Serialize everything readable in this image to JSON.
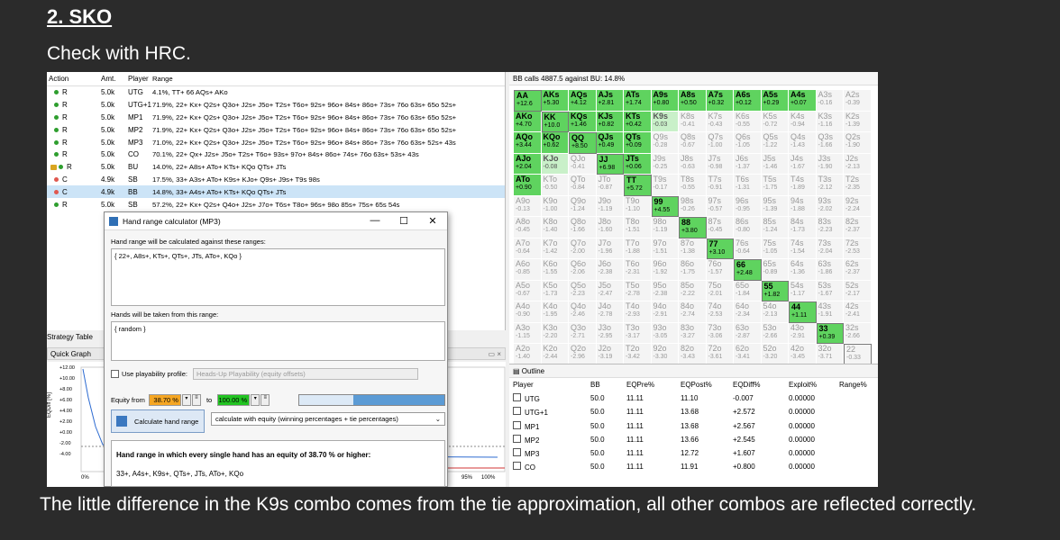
{
  "slide": {
    "title": "2. SKO",
    "subtitle": "Check with HRC.",
    "caption": "The little difference in the K9s combo comes from the tie approximation, all other combos are reflected correctly."
  },
  "action_table": {
    "headers": {
      "action": "Action",
      "amt": "Amt.",
      "player": "Player",
      "range": "Range"
    },
    "rows": [
      {
        "action": "R",
        "amt": "5.0k",
        "player": "UTG",
        "range": "4.1%, TT+ 66 AQs+ AKo",
        "color": "#2e9e2e"
      },
      {
        "action": "R",
        "amt": "5.0k",
        "player": "UTG+1",
        "range": "71.9%, 22+ Kx+ Q2s+ Q3o+ J2s+ J5o+ T2s+ T6o+ 92s+ 96o+ 84s+ 86o+ 73s+ 76o 63s+ 65o 52s+",
        "color": "#2e9e2e"
      },
      {
        "action": "R",
        "amt": "5.0k",
        "player": "MP1",
        "range": "71.9%, 22+ Kx+ Q2s+ Q3o+ J2s+ J5o+ T2s+ T6o+ 92s+ 96o+ 84s+ 86o+ 73s+ 76o 63s+ 65o 52s+",
        "color": "#2e9e2e"
      },
      {
        "action": "R",
        "amt": "5.0k",
        "player": "MP2",
        "range": "71.9%, 22+ Kx+ Q2s+ Q3o+ J2s+ J5o+ T2s+ T6o+ 92s+ 96o+ 84s+ 86o+ 73s+ 76o 63s+ 65o 52s+",
        "color": "#2e9e2e"
      },
      {
        "action": "R",
        "amt": "5.0k",
        "player": "MP3",
        "range": "71.0%, 22+ Kx+ Q2s+ Q3o+ J2s+ J5o+ T2s+ T6o+ 92s+ 96o+ 84s+ 86o+ 73s+ 76o 63s+ 52s+ 43s",
        "color": "#2e9e2e"
      },
      {
        "action": "R",
        "amt": "5.0k",
        "player": "CO",
        "range": "70.1%, 22+ Qx+ J2s+ J5o+ T2s+ T6o+ 93s+ 97o+ 84s+ 86o+ 74s+ 76o 63s+ 53s+ 43s",
        "color": "#2e9e2e"
      },
      {
        "action": "R",
        "amt": "5.0k",
        "player": "BU",
        "range": "14.0%, 22+ A8s+ ATo+ KTs+ KQo QTs+ JTs",
        "color": "#2e9e2e",
        "lock": true
      },
      {
        "action": "C",
        "amt": "4.9k",
        "player": "SB",
        "range": "17.5%, 33+ A3s+ ATo+ K9s+ KJo+ Q9s+ J9s+ T9s 98s",
        "color": "#e0584f"
      },
      {
        "action": "C",
        "amt": "4.9k",
        "player": "BB",
        "range": "14.8%, 33+ A4s+ ATo+ KTs+ KQo QTs+ JTs",
        "color": "#e0584f",
        "selected": true
      },
      {
        "action": "R",
        "amt": "5.0k",
        "player": "SB",
        "range": "57.2%, 22+ Kx+ Q2s+ Q4o+ J2s+ J7o+ T6s+ T8o+ 96s+ 98o 85s+ 75s+ 65s 54s",
        "color": "#2e9e2e"
      }
    ]
  },
  "strategy_table_label": "Strategy Table",
  "quick_graph": {
    "label": "Quick Graph",
    "ylabel": "EQDiff [%]",
    "yticks": [
      "+12.00",
      "+10.00",
      "+8.00",
      "+6.00",
      "+4.00",
      "+2.00",
      "+0.00",
      "-2.00",
      "-4.00"
    ],
    "xticks": [
      "0%",
      "95%",
      "100%"
    ]
  },
  "dialog": {
    "title": "Hand range calculator (MP3)",
    "against_label": "Hand range will be calculated against these ranges:",
    "against_value": "{ 22+, A8s+, KTs+, QTs+, JTs, ATo+, KQo }",
    "taken_label": "Hands will be taken from this range:",
    "taken_value": "{ random }",
    "playability_label": "Use playability profile:",
    "playability_value": "Heads-Up Playability (equity offsets)",
    "equity_from_label": "Equity from",
    "equity_from_value": "38.70 %",
    "to_label": "to",
    "to_value": "100.00 %",
    "calc_button": "Calculate hand range",
    "method": "calculate with equity (winning percentages + tie percentages)",
    "result_heading": "Hand range in which every single hand has an equity of 38.70 % or higher:",
    "result_value": "33+, A4s+, K9s+, QTs+, JTs, ATo+, KQo"
  },
  "matrix": {
    "header": "BB calls 4887.5 against BU: 14.8%",
    "cells": [
      [
        "AA",
        "+12.6"
      ],
      [
        "AKs",
        "+5.30"
      ],
      [
        "AQs",
        "+4.12"
      ],
      [
        "AJs",
        "+2.81"
      ],
      [
        "ATs",
        "+1.74"
      ],
      [
        "A9s",
        "+0.80"
      ],
      [
        "A8s",
        "+0.50"
      ],
      [
        "A7s",
        "+0.32"
      ],
      [
        "A6s",
        "+0.12"
      ],
      [
        "A5s",
        "+0.29"
      ],
      [
        "A4s",
        "+0.07"
      ],
      [
        "A3s",
        "-0.16"
      ],
      [
        "A2s",
        "-0.39"
      ],
      [
        "AKo",
        "+4.70"
      ],
      [
        "KK",
        "+10.0"
      ],
      [
        "KQs",
        "+1.46"
      ],
      [
        "KJs",
        "+0.82"
      ],
      [
        "KTs",
        "+0.42"
      ],
      [
        "K9s",
        "-0.03"
      ],
      [
        "K8s",
        "-0.41"
      ],
      [
        "K7s",
        "-0.43"
      ],
      [
        "K6s",
        "-0.55"
      ],
      [
        "K5s",
        "-0.72"
      ],
      [
        "K4s",
        "-0.94"
      ],
      [
        "K3s",
        "-1.16"
      ],
      [
        "K2s",
        "-1.39"
      ],
      [
        "AQo",
        "+3.44"
      ],
      [
        "KQo",
        "+0.62"
      ],
      [
        "QQ",
        "+8.50"
      ],
      [
        "QJs",
        "+0.49"
      ],
      [
        "QTs",
        "+0.09"
      ],
      [
        "Q9s",
        "-0.28"
      ],
      [
        "Q8s",
        "-0.67"
      ],
      [
        "Q7s",
        "-1.00"
      ],
      [
        "Q6s",
        "-1.05"
      ],
      [
        "Q5s",
        "-1.22"
      ],
      [
        "Q4s",
        "-1.43"
      ],
      [
        "Q3s",
        "-1.66"
      ],
      [
        "Q2s",
        "-1.90"
      ],
      [
        "AJo",
        "+2.04"
      ],
      [
        "KJo",
        "-0.08"
      ],
      [
        "QJo",
        "-0.41"
      ],
      [
        "JJ",
        "+6.98"
      ],
      [
        "JTs",
        "+0.06"
      ],
      [
        "J9s",
        "-0.25"
      ],
      [
        "J8s",
        "-0.63"
      ],
      [
        "J7s",
        "-0.98"
      ],
      [
        "J6s",
        "-1.37"
      ],
      [
        "J5s",
        "-1.46"
      ],
      [
        "J4s",
        "-1.67"
      ],
      [
        "J3s",
        "-1.90"
      ],
      [
        "J2s",
        "-2.13"
      ],
      [
        "ATo",
        "+0.90"
      ],
      [
        "KTo",
        "-0.50"
      ],
      [
        "QTo",
        "-0.84"
      ],
      [
        "JTo",
        "-0.87"
      ],
      [
        "TT",
        "+5.72"
      ],
      [
        "T9s",
        "-0.17"
      ],
      [
        "T8s",
        "-0.55"
      ],
      [
        "T7s",
        "-0.91"
      ],
      [
        "T6s",
        "-1.31"
      ],
      [
        "T5s",
        "-1.75"
      ],
      [
        "T4s",
        "-1.89"
      ],
      [
        "T3s",
        "-2.12"
      ],
      [
        "T2s",
        "-2.35"
      ],
      [
        "A9o",
        "-0.13"
      ],
      [
        "K9o",
        "-1.00"
      ],
      [
        "Q9o",
        "-1.24"
      ],
      [
        "J9o",
        "-1.19"
      ],
      [
        "T9o",
        "-1.10"
      ],
      [
        "99",
        "+4.55"
      ],
      [
        "98s",
        "-0.26"
      ],
      [
        "97s",
        "-0.57"
      ],
      [
        "96s",
        "-0.95"
      ],
      [
        "95s",
        "-1.39"
      ],
      [
        "94s",
        "-1.88"
      ],
      [
        "93s",
        "-2.02"
      ],
      [
        "92s",
        "-2.24"
      ],
      [
        "A8o",
        "-0.45"
      ],
      [
        "K8o",
        "-1.40"
      ],
      [
        "Q8o",
        "-1.66"
      ],
      [
        "J8o",
        "-1.60"
      ],
      [
        "T8o",
        "-1.51"
      ],
      [
        "98o",
        "-1.19"
      ],
      [
        "88",
        "+3.80"
      ],
      [
        "87s",
        "-0.45"
      ],
      [
        "86s",
        "-0.80"
      ],
      [
        "85s",
        "-1.24"
      ],
      [
        "84s",
        "-1.73"
      ],
      [
        "83s",
        "-2.23"
      ],
      [
        "82s",
        "-2.37"
      ],
      [
        "A7o",
        "-0.64"
      ],
      [
        "K7o",
        "-1.42"
      ],
      [
        "Q7o",
        "-2.00"
      ],
      [
        "J7o",
        "-1.96"
      ],
      [
        "T7o",
        "-1.88"
      ],
      [
        "97o",
        "-1.51"
      ],
      [
        "87o",
        "-1.38"
      ],
      [
        "77",
        "+3.10"
      ],
      [
        "76s",
        "-0.64"
      ],
      [
        "75s",
        "-1.05"
      ],
      [
        "74s",
        "-1.54"
      ],
      [
        "73s",
        "-2.04"
      ],
      [
        "72s",
        "-2.53"
      ],
      [
        "A6o",
        "-0.85"
      ],
      [
        "K6o",
        "-1.55"
      ],
      [
        "Q6o",
        "-2.06"
      ],
      [
        "J6o",
        "-2.38"
      ],
      [
        "T6o",
        "-2.31"
      ],
      [
        "96o",
        "-1.92"
      ],
      [
        "86o",
        "-1.75"
      ],
      [
        "76o",
        "-1.57"
      ],
      [
        "66",
        "+2.48"
      ],
      [
        "65s",
        "-0.89"
      ],
      [
        "64s",
        "-1.36"
      ],
      [
        "63s",
        "-1.86"
      ],
      [
        "62s",
        "-2.37"
      ],
      [
        "A5o",
        "-0.67"
      ],
      [
        "K5o",
        "-1.73"
      ],
      [
        "Q5o",
        "-2.23"
      ],
      [
        "J5o",
        "-2.47"
      ],
      [
        "T5o",
        "-2.78"
      ],
      [
        "95o",
        "-2.38"
      ],
      [
        "85o",
        "-2.22"
      ],
      [
        "75o",
        "-2.01"
      ],
      [
        "65o",
        "-1.84"
      ],
      [
        "55",
        "+1.82"
      ],
      [
        "54s",
        "-1.17"
      ],
      [
        "53s",
        "-1.67"
      ],
      [
        "52s",
        "-2.17"
      ],
      [
        "A4o",
        "-0.90"
      ],
      [
        "K4o",
        "-1.95"
      ],
      [
        "Q4o",
        "-2.46"
      ],
      [
        "J4o",
        "-2.78"
      ],
      [
        "T4o",
        "-2.93"
      ],
      [
        "94o",
        "-2.91"
      ],
      [
        "84o",
        "-2.74"
      ],
      [
        "74o",
        "-2.53"
      ],
      [
        "64o",
        "-2.34"
      ],
      [
        "54o",
        "-2.13"
      ],
      [
        "44",
        "+1.11"
      ],
      [
        "43s",
        "-1.91"
      ],
      [
        "42s",
        "-2.41"
      ],
      [
        "A3o",
        "-1.15"
      ],
      [
        "K3o",
        "-2.20"
      ],
      [
        "Q3o",
        "-2.71"
      ],
      [
        "J3o",
        "-2.95"
      ],
      [
        "T3o",
        "-3.17"
      ],
      [
        "93o",
        "-3.05"
      ],
      [
        "83o",
        "-3.27"
      ],
      [
        "73o",
        "-3.06"
      ],
      [
        "63o",
        "-2.87"
      ],
      [
        "53o",
        "-2.66"
      ],
      [
        "43o",
        "-2.91"
      ],
      [
        "33",
        "+0.39"
      ],
      [
        "32s",
        "-2.66"
      ],
      [
        "A2o",
        "-1.40"
      ],
      [
        "K2o",
        "-2.44"
      ],
      [
        "Q2o",
        "-2.96"
      ],
      [
        "J2o",
        "-3.19"
      ],
      [
        "T2o",
        "-3.42"
      ],
      [
        "92o",
        "-3.30"
      ],
      [
        "82o",
        "-3.43"
      ],
      [
        "72o",
        "-3.61"
      ],
      [
        "62o",
        "-3.41"
      ],
      [
        "52o",
        "-3.20"
      ],
      [
        "42o",
        "-3.45"
      ],
      [
        "32o",
        "-3.71"
      ],
      [
        "22",
        "-0.33"
      ]
    ]
  },
  "outline": {
    "title": "Outline",
    "headers": [
      "Player",
      "BB",
      "EQPre%",
      "EQPost%",
      "EQDiff%",
      "Exploit%",
      "Range%"
    ],
    "rows": [
      [
        "UTG",
        "50.0",
        "11.11",
        "11.10",
        "-0.007",
        "0.00000",
        ""
      ],
      [
        "UTG+1",
        "50.0",
        "11.11",
        "13.68",
        "+2.572",
        "0.00000",
        ""
      ],
      [
        "MP1",
        "50.0",
        "11.11",
        "13.68",
        "+2.567",
        "0.00000",
        ""
      ],
      [
        "MP2",
        "50.0",
        "11.11",
        "13.66",
        "+2.545",
        "0.00000",
        ""
      ],
      [
        "MP3",
        "50.0",
        "11.11",
        "12.72",
        "+1.607",
        "0.00000",
        ""
      ],
      [
        "CO",
        "50.0",
        "11.11",
        "11.91",
        "+0.800",
        "0.00000",
        ""
      ]
    ]
  }
}
